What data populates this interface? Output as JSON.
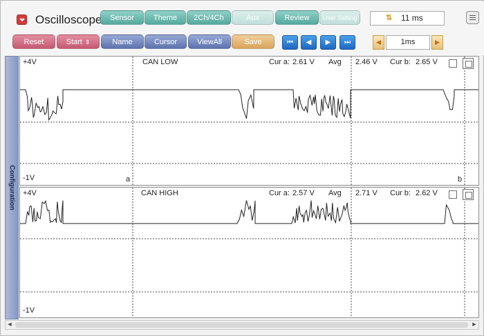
{
  "app": {
    "title": "Oscilloscope"
  },
  "toolbar_top": [
    {
      "label": "Sensor"
    },
    {
      "label": "Theme"
    },
    {
      "label": "2Ch/4Ch"
    },
    {
      "label": "Aux"
    },
    {
      "label": "Review"
    },
    {
      "label": "User Setting"
    }
  ],
  "toolbar_bottom": [
    {
      "label": "Reset"
    },
    {
      "label": "Start"
    },
    {
      "label": "Name"
    },
    {
      "label": "Cursor"
    },
    {
      "label": "ViewAll"
    },
    {
      "label": "Save"
    }
  ],
  "timebase": {
    "value": "11 ms",
    "icon": "timebase-icon"
  },
  "step": {
    "value": "1ms"
  },
  "sidebar": {
    "tab_label": "Configuration"
  },
  "channels": [
    {
      "name": "CAN LOW",
      "ymax": "+4V",
      "ymin": "-1V",
      "cur_a_label": "Cur a:",
      "cur_a": "2.61 V",
      "avg_label": "Avg",
      "avg": "2.46 V",
      "cur_b_label": "Cur b:",
      "cur_b": "2.65 V",
      "cursor_a_label": "a",
      "cursor_b_label": "b"
    },
    {
      "name": "CAN HIGH",
      "ymax": "+4V",
      "ymin": "-1V",
      "cur_a_label": "Cur a:",
      "cur_a": "2.57 V",
      "avg_label": "Avg",
      "avg": "2.71 V",
      "cur_b_label": "Cur b:",
      "cur_b": "2.62 V"
    }
  ],
  "colors": {
    "trace": "#222222",
    "grid": "#444444",
    "button_teal": "#6ab9ae",
    "button_red": "#d4728a",
    "button_blue": "#7a8fc4",
    "button_orange": "#e6b977",
    "nav_blue": "#2f7fd6"
  }
}
